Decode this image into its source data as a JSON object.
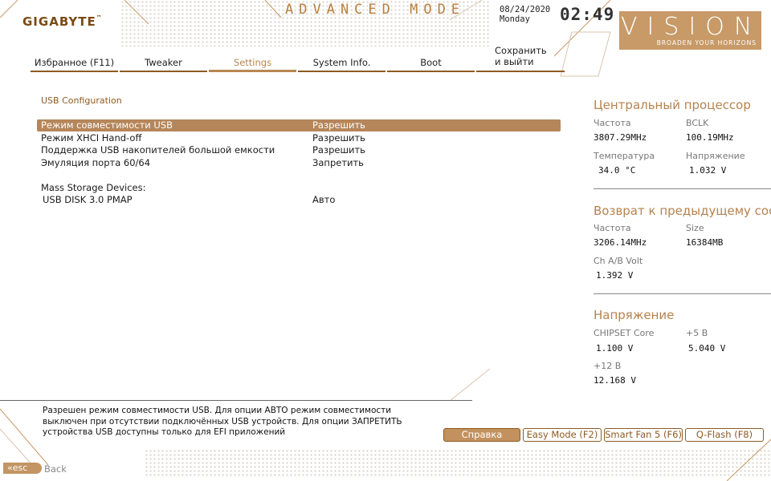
{
  "brand": {
    "logo": "GIGABYTE",
    "trademark": "™"
  },
  "header": {
    "mode_title": "ADVANCED MODE",
    "date": "08/24/2020",
    "weekday": "Monday",
    "time": "02:49",
    "vision_title": "VISION",
    "vision_tagline": "BROADEN YOUR HORIZONS"
  },
  "tabs": [
    {
      "label": "Избранное (F11)"
    },
    {
      "label": "Tweaker"
    },
    {
      "label": "Settings",
      "active": true
    },
    {
      "label": "System Info."
    },
    {
      "label": "Boot"
    }
  ],
  "save_tab": {
    "line1": "Сохранить",
    "line2": "и выйти"
  },
  "main": {
    "section_title": "USB Configuration",
    "settings": [
      {
        "label": "Режим совместимости USB",
        "value": "Разрешить",
        "selected": true
      },
      {
        "label": "Режим XHCI Hand-off",
        "value": "Разрешить"
      },
      {
        "label": "Поддержка USB накопителей большой емкости",
        "value": "Разрешить"
      },
      {
        "label": "Эмуляция порта 60/64",
        "value": "Запретить"
      }
    ],
    "mass_storage_header": "Mass Storage Devices:",
    "devices": [
      {
        "label": "USB DISK 3.0 PMAP",
        "value": "Авто"
      }
    ]
  },
  "sidebar": {
    "cpu": {
      "title": "Центральный процессор",
      "freq_label": "Частота",
      "freq_value": "3807.29MHz",
      "bclk_label": "BCLK",
      "bclk_value": "100.19MHz",
      "temp_label": "Температура",
      "temp_value": "34.0 °C",
      "volt_label": "Напряжение",
      "volt_value": "1.032 V"
    },
    "memory": {
      "title": "Возврат к предыдущему сост",
      "freq_label": "Частота",
      "freq_value": "3206.14MHz",
      "size_label": "Size",
      "size_value": "16384MB",
      "volt_label": "Ch A/B Volt",
      "volt_value": "1.392 V"
    },
    "voltage": {
      "title": "Напряжение",
      "chipset_label": "CHIPSET Core",
      "chipset_value": "1.100 V",
      "v5_label": "+5 В",
      "v5_value": "5.040 V",
      "v12_label": "+12 В",
      "v12_value": "12.168 V"
    }
  },
  "help_text": "Разрешен режим совместимости USB. Для опции АВТО режим совместимости выключен при отсутствии подключённых USB устройств. Для опции ЗАПРЕТИТЬ устройства USB доступны только для EFI приложений",
  "footer": {
    "buttons": [
      {
        "label": "Справка"
      },
      {
        "label": "Easy Mode (F2)"
      },
      {
        "label": "Smart Fan 5 (F6)"
      },
      {
        "label": "Q-Flash (F8)"
      }
    ],
    "esc_label": "esc",
    "back_label": "Back"
  },
  "colors": {
    "accent": "#b5865a",
    "accent_dark": "#8d5b23",
    "text": "#1a1a1a"
  }
}
